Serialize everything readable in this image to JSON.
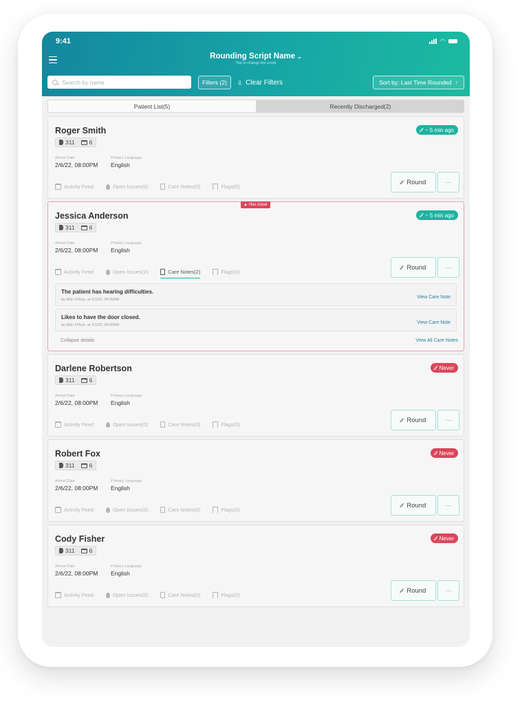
{
  "status_bar": {
    "time": "9:41"
  },
  "header": {
    "title": "Rounding Script Name",
    "subtitle": "Tap to change the script",
    "search_placeholder": "Search by name",
    "filters_label": "Filters (2)",
    "clear_filters_label": "Clear Filters",
    "sort_label": "Sort by: Last Time Rounded"
  },
  "tabs": [
    {
      "label": "Patient List(5)",
      "active": true
    },
    {
      "label": "Recently Discharged(2)",
      "active": false
    }
  ],
  "labels": {
    "arrival_date": "Arrival Date",
    "primary_language": "Primary Language",
    "round": "Round",
    "more": "···",
    "has_issue": "Has Issue",
    "collapse": "Collapse details",
    "view_all": "View All Care Notes",
    "view_note": "View Care Note"
  },
  "patients": [
    {
      "name": "Roger Smith",
      "room": "311",
      "bed": "6",
      "arrival": "2/6/22, 08:00PM",
      "language": "English",
      "last_rounded": "~ 5 min ago",
      "status": "recent",
      "actions": [
        "Activity Feed",
        "Open Issues(0)",
        "Care Notes(0)",
        "Flags(0)"
      ]
    },
    {
      "name": "Jessica Anderson",
      "room": "311",
      "bed": "6",
      "arrival": "2/6/22, 08:00PM",
      "language": "English",
      "last_rounded": "~ 5 min ago",
      "status": "recent",
      "has_issue": true,
      "actions": [
        "Activity Feed",
        "Open Issues(2)",
        "Care Notes(2)",
        "Flags(0)"
      ],
      "care_notes": [
        {
          "text": "The patient has hearing difficulties.",
          "by": "by Ekin Orhun, at 2/1/22, 08:00AM"
        },
        {
          "text": "Likes to have the door closed.",
          "by": "by Ekin Orhun, at 2/1/22, 08:00AM"
        }
      ]
    },
    {
      "name": "Darlene Robertson",
      "room": "311",
      "bed": "6",
      "arrival": "2/6/22, 08:00PM",
      "language": "English",
      "last_rounded": "Never",
      "status": "never",
      "actions": [
        "Activity Feed",
        "Open Issues(0)",
        "Care Notes(0)",
        "Flags(0)"
      ]
    },
    {
      "name": "Robert Fox",
      "room": "311",
      "bed": "6",
      "arrival": "2/6/22, 08:00PM",
      "language": "English",
      "last_rounded": "Never",
      "status": "never",
      "actions": [
        "Activity Feed",
        "Open Issues(0)",
        "Care Notes(0)",
        "Flags(0)"
      ]
    },
    {
      "name": "Cody Fisher",
      "room": "311",
      "bed": "6",
      "arrival": "2/6/22, 08:00PM",
      "language": "English",
      "last_rounded": "Never",
      "status": "never",
      "actions": [
        "Activity Feed",
        "Open Issues(0)",
        "Care Notes(0)",
        "Flags(0)"
      ]
    }
  ]
}
